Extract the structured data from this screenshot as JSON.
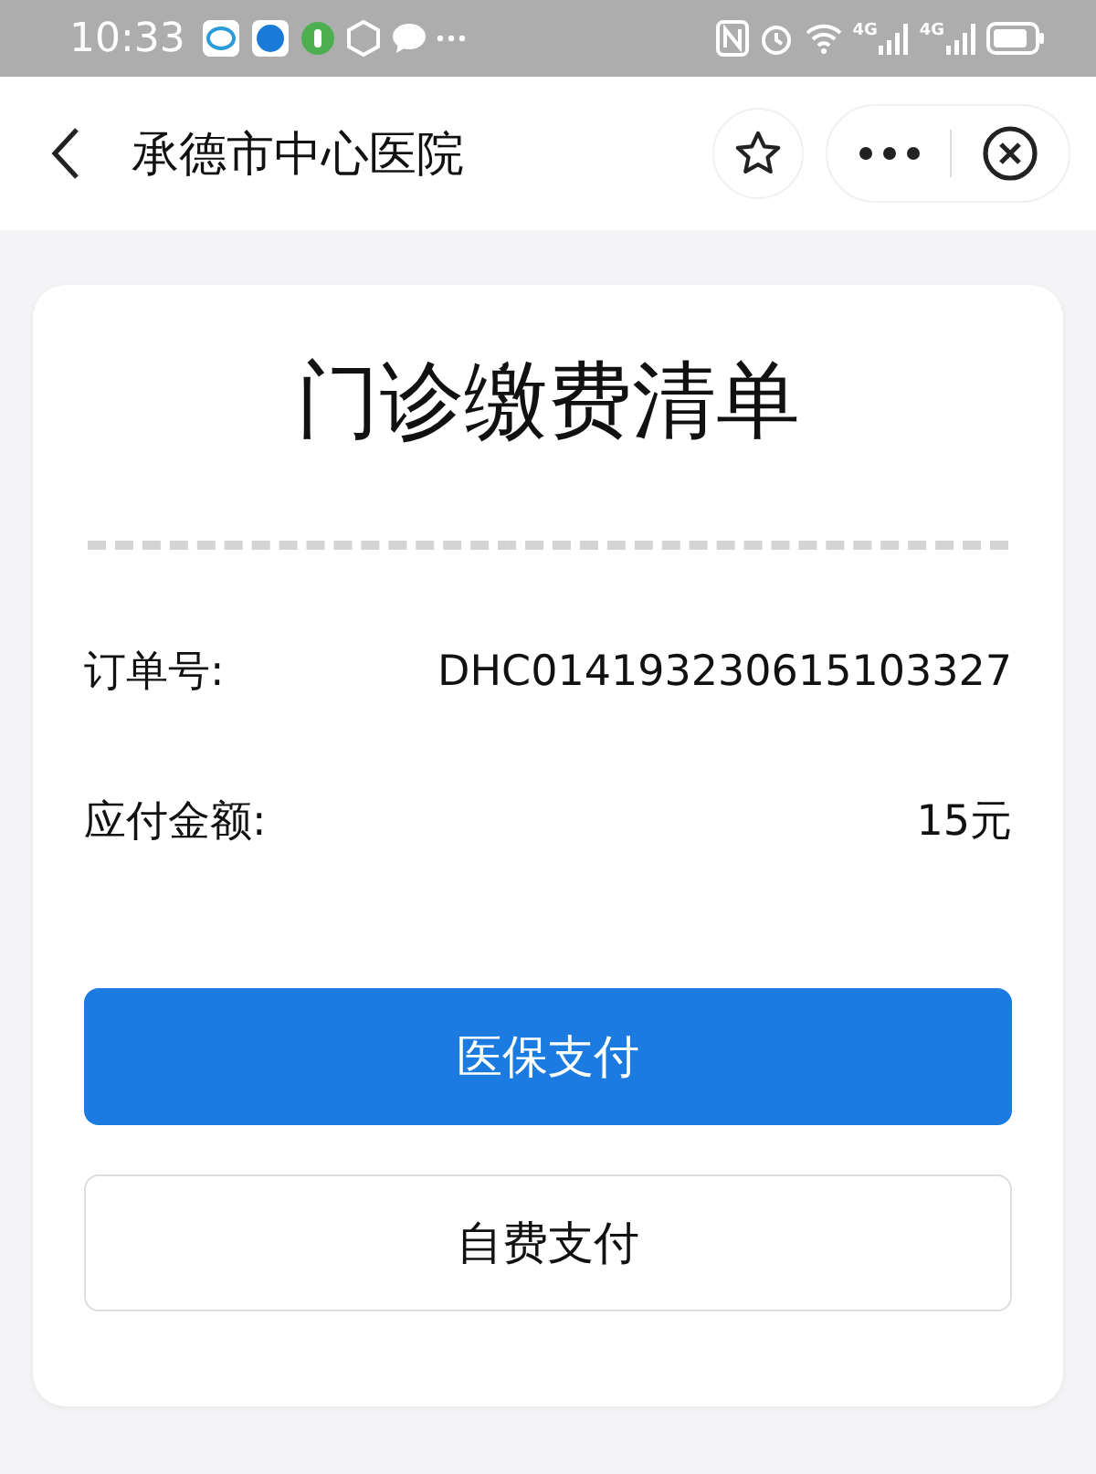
{
  "status_bar": {
    "time": "10:33",
    "network_labels": [
      "4G",
      "4G"
    ]
  },
  "header": {
    "title": "承德市中心医院"
  },
  "bill": {
    "title": "门诊缴费清单",
    "rows": [
      {
        "label": "订单号:",
        "value": "DHC014193230615103327"
      },
      {
        "label": "应付金额:",
        "value": "15元"
      }
    ],
    "buttons": [
      {
        "label": "医保支付",
        "kind": "primary"
      },
      {
        "label": "自费支付",
        "kind": "secondary"
      }
    ]
  }
}
